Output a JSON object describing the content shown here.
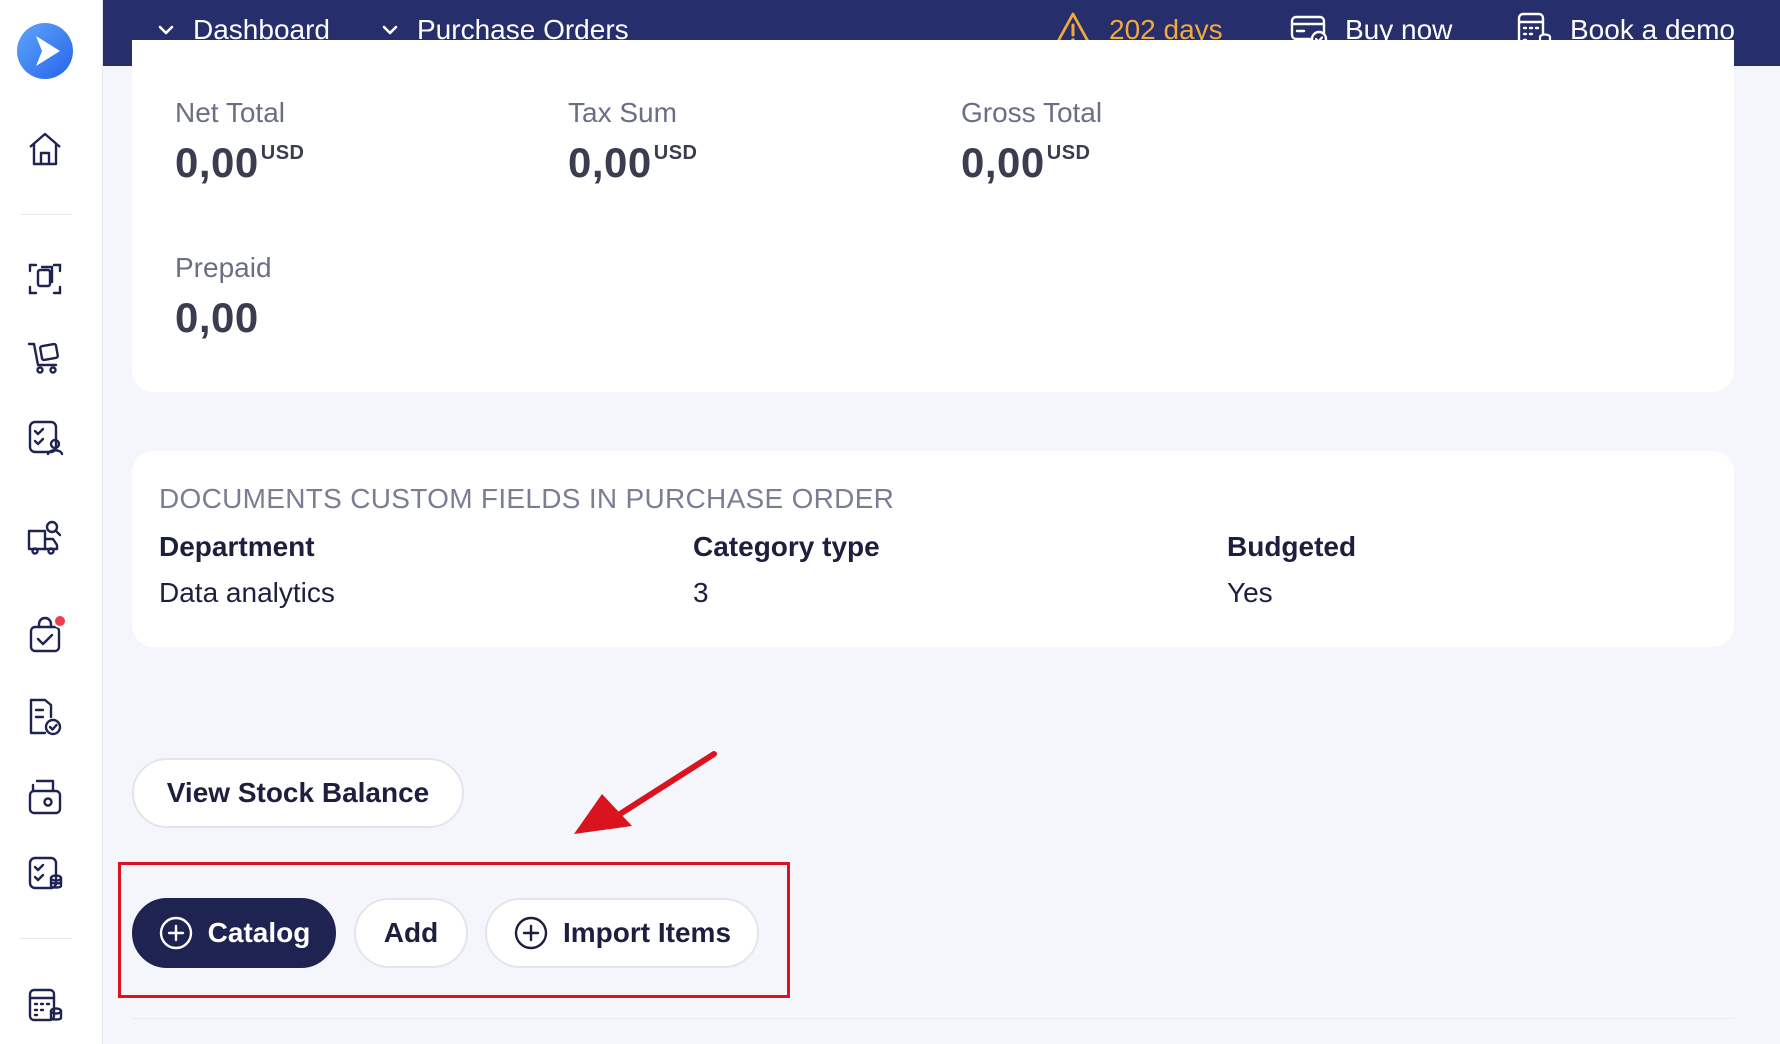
{
  "topbar": {
    "breadcrumb": [
      {
        "label": "Dashboard"
      },
      {
        "label": "Purchase Orders"
      }
    ],
    "trial": {
      "text": "202 days",
      "icon": "warning-icon"
    },
    "buy_now": {
      "label": "Buy now",
      "icon": "card-check-icon"
    },
    "book_demo": {
      "label": "Book a demo",
      "icon": "calculator-icon"
    }
  },
  "sidebar": {
    "items": [
      {
        "name": "home-icon"
      },
      {
        "name": "documents-scan-icon"
      },
      {
        "name": "cart-doc-icon"
      },
      {
        "name": "checklist-user-icon"
      },
      {
        "name": "truck-search-icon"
      },
      {
        "name": "bag-check-icon",
        "notification": true
      },
      {
        "name": "doc-check-icon"
      },
      {
        "name": "wallet-doc-icon"
      },
      {
        "name": "checklist-db-icon"
      },
      {
        "name": "calculator-db-icon"
      }
    ]
  },
  "summary": {
    "net_total": {
      "label": "Net Total",
      "value": "0,00",
      "currency": "USD"
    },
    "tax_sum": {
      "label": "Tax Sum",
      "value": "0,00",
      "currency": "USD"
    },
    "gross_total": {
      "label": "Gross Total",
      "value": "0,00",
      "currency": "USD"
    },
    "prepaid": {
      "label": "Prepaid",
      "value": "0,00"
    }
  },
  "custom_fields": {
    "title": "DOCUMENTS CUSTOM FIELDS IN PURCHASE ORDER",
    "fields": [
      {
        "label": "Department",
        "value": "Data analytics"
      },
      {
        "label": "Category type",
        "value": "3"
      },
      {
        "label": "Budgeted",
        "value": "Yes"
      }
    ]
  },
  "actions": {
    "view_stock_balance": "View Stock Balance",
    "catalog": "Catalog",
    "add": "Add",
    "import_items": "Import Items"
  },
  "colors": {
    "topbar": "#262e6b",
    "accent_dark": "#1f2352",
    "warning": "#f2a93b",
    "highlight": "#d9141e",
    "logo": "#3b82f6"
  }
}
